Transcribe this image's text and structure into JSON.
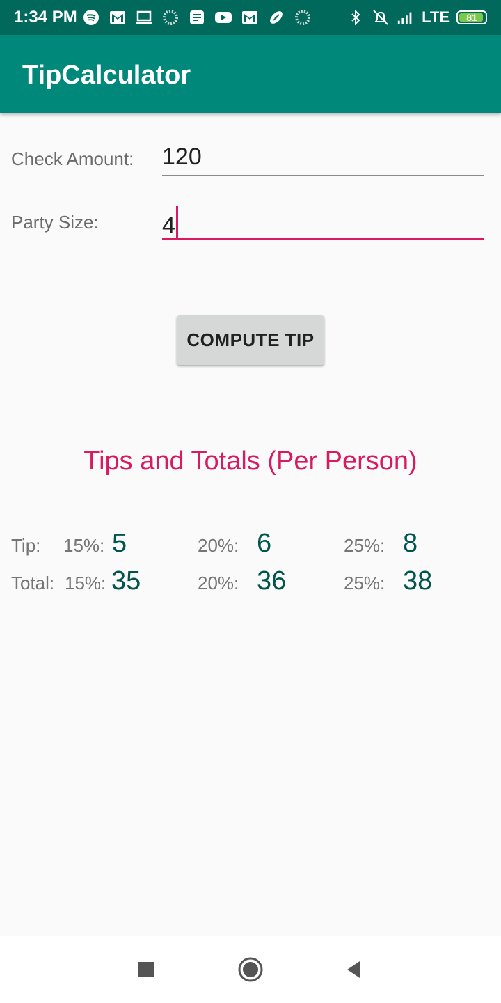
{
  "status_bar": {
    "time": "1:34 PM",
    "network": "LTE",
    "battery": "81",
    "left_icons": [
      "spotify-icon",
      "gmail-icon",
      "laptop-icon",
      "loading-icon",
      "news-icon",
      "youtube-icon",
      "gmail-icon",
      "football-icon",
      "loading-icon"
    ],
    "right_icons": [
      "bluetooth-icon",
      "alarm-off-icon",
      "signal-icon",
      "battery-icon"
    ]
  },
  "app_bar": {
    "title": "TipCalculator"
  },
  "form": {
    "check_amount_label": "Check Amount:",
    "check_amount_value": "120",
    "party_size_label": "Party Size:",
    "party_size_value": "4"
  },
  "compute_button": {
    "label": "COMPUTE TIP"
  },
  "results": {
    "title": "Tips and Totals (Per Person)",
    "tip_label": "Tip:",
    "total_label": "Total:",
    "tip": [
      {
        "percent": "15%:",
        "value": "5"
      },
      {
        "percent": "20%:",
        "value": "6"
      },
      {
        "percent": "25%:",
        "value": "8"
      }
    ],
    "total": [
      {
        "percent": "15%:",
        "value": "35"
      },
      {
        "percent": "20%:",
        "value": "36"
      },
      {
        "percent": "25%:",
        "value": "38"
      }
    ]
  },
  "colors": {
    "status_bar": "#00695c",
    "app_bar": "#00897b",
    "accent": "#d81b60",
    "result_value": "#00564d"
  }
}
